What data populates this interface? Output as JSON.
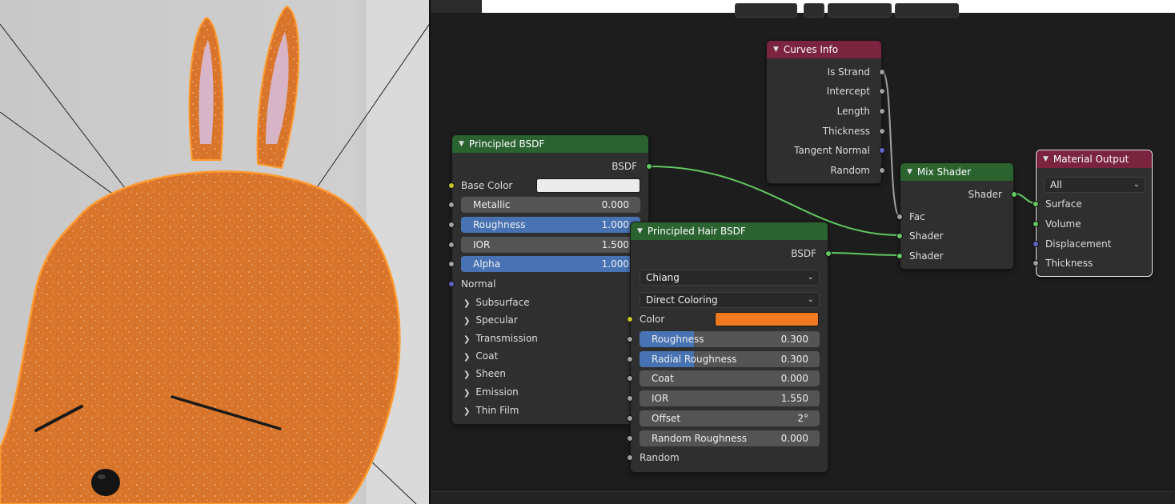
{
  "principled_bsdf": {
    "title": "Principled BSDF",
    "output": "BSDF",
    "base_color_label": "Base Color",
    "base_color": "#ececec",
    "metallic": {
      "label": "Metallic",
      "value": "0.000",
      "fraction": 0
    },
    "roughness": {
      "label": "Roughness",
      "value": "1.000",
      "fraction": 1
    },
    "ior": {
      "label": "IOR",
      "value": "1.500",
      "fraction": 0
    },
    "alpha": {
      "label": "Alpha",
      "value": "1.000",
      "fraction": 1
    },
    "normal": "Normal",
    "panels": [
      "Subsurface",
      "Specular",
      "Transmission",
      "Coat",
      "Sheen",
      "Emission",
      "Thin Film"
    ]
  },
  "curves_info": {
    "title": "Curves Info",
    "outputs": [
      "Is Strand",
      "Intercept",
      "Length",
      "Thickness",
      "Tangent Normal",
      "Random"
    ]
  },
  "hair_bsdf": {
    "title": "Principled Hair BSDF",
    "output": "BSDF",
    "model": "Chiang",
    "parametrization": "Direct Coloring",
    "color_label": "Color",
    "color": "#f07a20",
    "roughness": {
      "label": "Roughness",
      "value": "0.300",
      "fraction": 0.3
    },
    "radial_roughness": {
      "label": "Radial Roughness",
      "value": "0.300",
      "fraction": 0.3
    },
    "coat": {
      "label": "Coat",
      "value": "0.000",
      "fraction": 0
    },
    "ior": {
      "label": "IOR",
      "value": "1.550",
      "fraction": 0
    },
    "offset": {
      "label": "Offset",
      "value": "2°",
      "fraction": 0
    },
    "random_roughness": {
      "label": "Random Roughness",
      "value": "0.000",
      "fraction": 0
    },
    "random": "Random"
  },
  "mix_shader": {
    "title": "Mix Shader",
    "output": "Shader",
    "inputs": [
      "Fac",
      "Shader",
      "Shader"
    ]
  },
  "material_output": {
    "title": "Material Output",
    "target": "All",
    "inputs": [
      "Surface",
      "Volume",
      "Displacement",
      "Thickness"
    ]
  },
  "colors": {
    "header_green": "#2a6230",
    "header_red": "#7a2440",
    "slider_blue": "#4772b3",
    "fur_orange": "#d9752a"
  }
}
